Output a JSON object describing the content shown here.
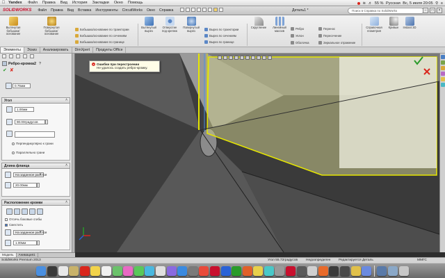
{
  "menubar": {
    "app": "Yandex",
    "items": [
      "Файл",
      "Правка",
      "Вид",
      "История",
      "Закладки",
      "Окно",
      "Помощь"
    ],
    "battery": "55 %",
    "lang": "Русская",
    "datetime": "Вс, 5 июля  20:05"
  },
  "titlebar": {
    "logo": "SOLIDWORKS",
    "menus": [
      "Файл",
      "Правка",
      "Вид",
      "Вставка",
      "Инструменты",
      "CircuitWorks",
      "Окно",
      "Справка"
    ],
    "document": "Деталь1 *",
    "search_placeholder": "Поиск в Справка по SolidWorks"
  },
  "ribbon": {
    "extrude_boss": "Вытянутая бобышка/основание",
    "revolve_boss": "Повернутая бобышка/основание",
    "boss_group": [
      "Бобышка/основание по траектории",
      "Бобышка/основание по сечениям",
      "Бобышка/основание по границе"
    ],
    "extrude_cut": "Вытянутый вырез",
    "hole_wizard": "Отверстие под крепеж",
    "revolve_cut": "Повернутый вырез",
    "cut_group": [
      "Вырез по траектории",
      "Вырез по сечениям",
      "Вырез по границе"
    ],
    "fillet": "Скругление",
    "linear_pattern": "Линейный массив",
    "feat_group": [
      "Ребро",
      "Уклон",
      "Оболочка"
    ],
    "feat_group2": [
      "Перенос",
      "Пересечение",
      "Зеркальное отражение"
    ],
    "ref_geometry": "Справочная геометрия",
    "curves": "Кривые",
    "instant3d": "Instant 3D"
  },
  "tabs": [
    "Элементы",
    "Эскиз",
    "Анализировать",
    "DimXpert",
    "Продукты Office"
  ],
  "panel": {
    "title": "Ребро-кромка2",
    "thickness": "0.75мм",
    "angle_header": "Угол",
    "angle_top": "1.00мм",
    "angle_value": "90.00градусов",
    "perp_to_face": "Перпендикулярно к грани",
    "parallel_to_face": "Параллельно грани",
    "length_header": "Длина фланца",
    "length_type": "На заданное расстоя",
    "length_value": "20.00мм",
    "position_header": "Расположение кромки",
    "trim_side_bends": "Отсечь боковые сгибы",
    "offset": "Сместить",
    "offset_type": "На заданное расстоя",
    "offset_value": "1.00мм"
  },
  "error": {
    "title": "Ошибки при перестроении",
    "message": "Не удалось создать ребро-кромку."
  },
  "bottom_tabs": [
    "Модель",
    "Анимация1"
  ],
  "status": {
    "product": "SolidWorks Premium 2013",
    "angle": "Угол 55.72градусов",
    "state": "Недоопределен",
    "editing": "Редактируется Деталь",
    "units": "ММГС"
  },
  "colors": {
    "viewport_bg": "#3b3b3b",
    "part_face": "#585858",
    "selection_yellow": "#e6e600",
    "error_red": "#d9261c",
    "sw_red": "#c8102e"
  }
}
